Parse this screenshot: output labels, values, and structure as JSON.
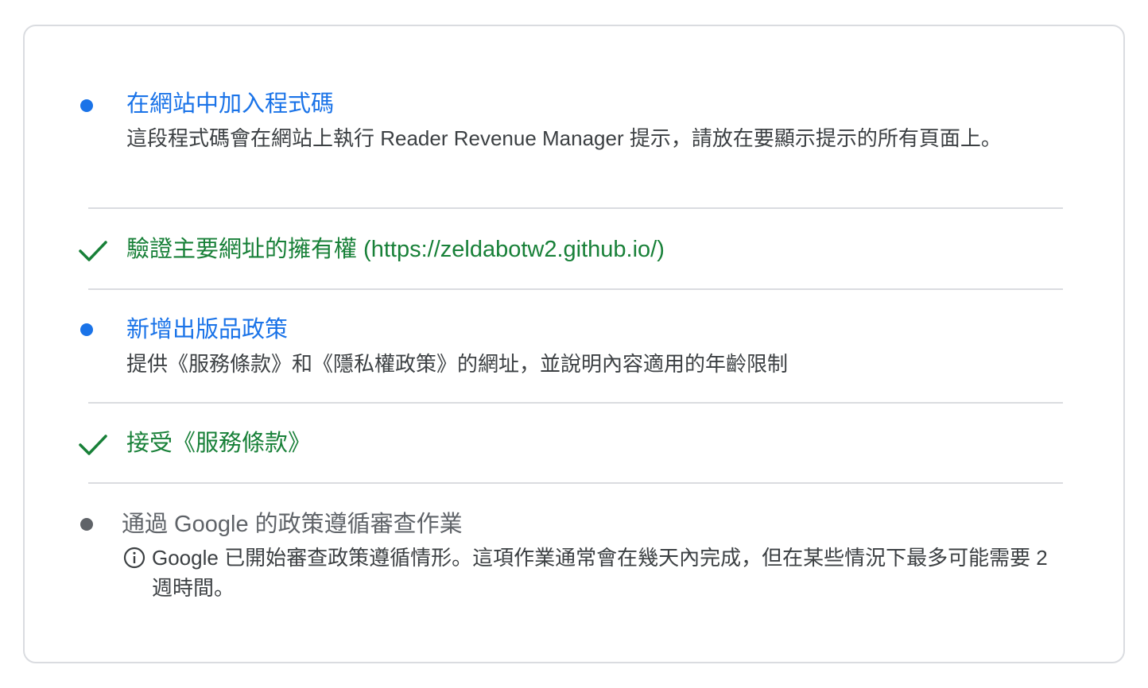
{
  "colors": {
    "link_blue": "#1a73e8",
    "done_green": "#188038",
    "pending_gray": "#5f6368",
    "divider": "#dadce0"
  },
  "steps": [
    {
      "status": "todo",
      "icon": "blue-dot-icon",
      "title": "在網站中加入程式碼",
      "description": "這段程式碼會在網站上執行 Reader Revenue Manager 提示，請放在要顯示提示的所有頁面上。"
    },
    {
      "status": "done",
      "icon": "checkmark-icon",
      "title": "驗證主要網址的擁有權 (https://zeldabotw2.github.io/)"
    },
    {
      "status": "todo",
      "icon": "blue-dot-icon",
      "title": "新增出版品政策",
      "description": "提供《服務條款》和《隱私權政策》的網址，並說明內容適用的年齡限制"
    },
    {
      "status": "done",
      "icon": "checkmark-icon",
      "title": "接受《服務條款》"
    },
    {
      "status": "in-review",
      "icon": "gray-dot-icon",
      "title": "通過 Google 的政策遵循審查作業",
      "info_icon": "info-icon",
      "note": "Google 已開始審查政策遵循情形。這項作業通常會在幾天內完成，但在某些情況下最多可能需要 2 週時間。"
    }
  ]
}
